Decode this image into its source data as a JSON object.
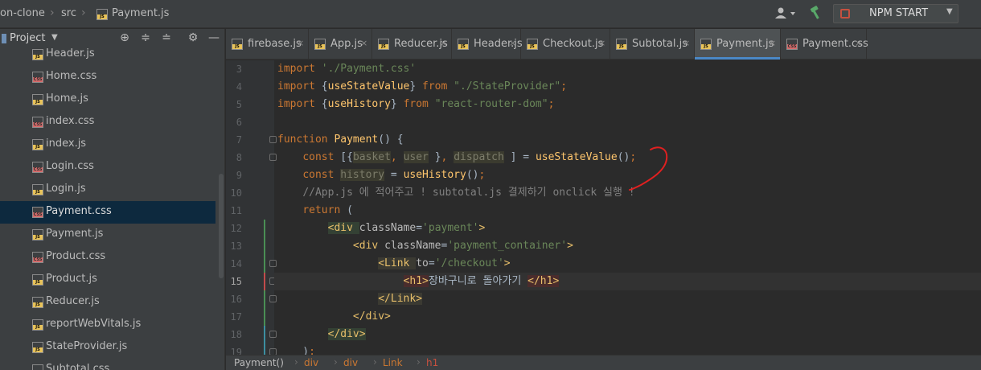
{
  "breadcrumb": {
    "project": "on-clone",
    "folder": "src",
    "file": "Payment.js"
  },
  "toolbar": {
    "run_config": "NPM START"
  },
  "sidebar": {
    "title": "Project",
    "files": [
      {
        "name": "Header.js",
        "type": "js"
      },
      {
        "name": "Home.css",
        "type": "css"
      },
      {
        "name": "Home.js",
        "type": "js"
      },
      {
        "name": "index.css",
        "type": "css"
      },
      {
        "name": "index.js",
        "type": "js"
      },
      {
        "name": "Login.css",
        "type": "css"
      },
      {
        "name": "Login.js",
        "type": "js"
      },
      {
        "name": "Payment.css",
        "type": "css",
        "selected": true
      },
      {
        "name": "Payment.js",
        "type": "js"
      },
      {
        "name": "Product.css",
        "type": "css"
      },
      {
        "name": "Product.js",
        "type": "js"
      },
      {
        "name": "Reducer.js",
        "type": "js"
      },
      {
        "name": "reportWebVitals.js",
        "type": "js"
      },
      {
        "name": "StateProvider.js",
        "type": "js"
      },
      {
        "name": "Subtotal.css",
        "type": "css"
      }
    ]
  },
  "tabs": [
    {
      "label": "firebase.js",
      "type": "js"
    },
    {
      "label": "App.js",
      "type": "js"
    },
    {
      "label": "Reducer.js",
      "type": "js"
    },
    {
      "label": "Header.js",
      "type": "js"
    },
    {
      "label": "Checkout.js",
      "type": "js"
    },
    {
      "label": "Subtotal.js",
      "type": "js"
    },
    {
      "label": "Payment.js",
      "type": "js",
      "active": true
    },
    {
      "label": "Payment.css",
      "type": "css"
    }
  ],
  "editor": {
    "current_line": 15,
    "lines": [
      {
        "n": 3,
        "html": "<span class=\"kw\">import </span><span class=\"str\">'./Payment.css'</span>"
      },
      {
        "n": 4,
        "html": "<span class=\"kw\">import </span>{<span class=\"fn\">useStateValue</span>} <span class=\"kw\">from </span><span class=\"str\">\"./StateProvider\"</span><span class=\"kw\">;</span>"
      },
      {
        "n": 5,
        "html": "<span class=\"kw\">import </span>{<span class=\"fn\">useHistory</span>} <span class=\"kw\">from </span><span class=\"str\">\"react-router-dom\"</span><span class=\"kw\">;</span>"
      },
      {
        "n": 6,
        "html": ""
      },
      {
        "n": 7,
        "html": "<span class=\"kw\">function </span><span class=\"fn\">Payment</span>() {"
      },
      {
        "n": 8,
        "html": "    <span class=\"kw\">const </span>[{<span class=\"unused\">basket</span><span class=\"kw\">, </span><span class=\"unused\">user</span> }<span class=\"kw\">, </span><span class=\"unused\">dispatch</span> ] = <span class=\"fn\">useStateValue</span>()<span class=\"kw\">;</span>"
      },
      {
        "n": 9,
        "html": "    <span class=\"kw\">const </span><span class=\"unused\">history</span> = <span class=\"fn\">useHistory</span>()<span class=\"kw\">;</span>"
      },
      {
        "n": 10,
        "html": "    <span class=\"cmt\">//App.js 에 적어주고 ! subtotal.js 결제하기 onclick 실행 !</span>"
      },
      {
        "n": 11,
        "html": "    <span class=\"kw\">return </span>("
      },
      {
        "n": 12,
        "html": "        <span class=\"hl-div\"><span class=\"tag\">&lt;div </span></span><span class=\"attr\">className</span>=<span class=\"str\">'payment'</span><span class=\"tag\">&gt;</span>"
      },
      {
        "n": 13,
        "html": "            <span class=\"tag\">&lt;div </span><span class=\"attr\">className</span>=<span class=\"str\">'payment_container'</span><span class=\"tag\">&gt;</span>"
      },
      {
        "n": 14,
        "html": "                <span class=\"hl-link\"><span class=\"tag\">&lt;Link </span></span><span class=\"attr\">to</span>=<span class=\"str\">'/checkout'</span><span class=\"tag\">&gt;</span>"
      },
      {
        "n": 15,
        "html": "                    <span class=\"hl-h1\"><span class=\"tag\">&lt;h1&gt;</span></span><span class=\"plain\">장바구니로 돌아가기 </span><span class=\"hl-h1\"><span class=\"tag\">&lt;/h1&gt;</span></span>"
      },
      {
        "n": 16,
        "html": "                <span class=\"hl-link\"><span class=\"tag\">&lt;/Link&gt;</span></span>"
      },
      {
        "n": 17,
        "html": "            <span class=\"tag\">&lt;/div&gt;</span>"
      },
      {
        "n": 18,
        "html": "        <span class=\"hl-div\"><span class=\"tag\">&lt;/div&gt;</span></span>"
      },
      {
        "n": 19,
        "html": "    )<span class=\"kw\">;</span>"
      }
    ]
  },
  "code_path": [
    "Payment()",
    "div",
    "div",
    "Link",
    "h1"
  ],
  "colors": {
    "accent": "#4a88c7",
    "keyword": "#cc7832",
    "string": "#6a8759",
    "function": "#ffc66d",
    "tag": "#e8bf6a",
    "annotation": "#e02020"
  }
}
